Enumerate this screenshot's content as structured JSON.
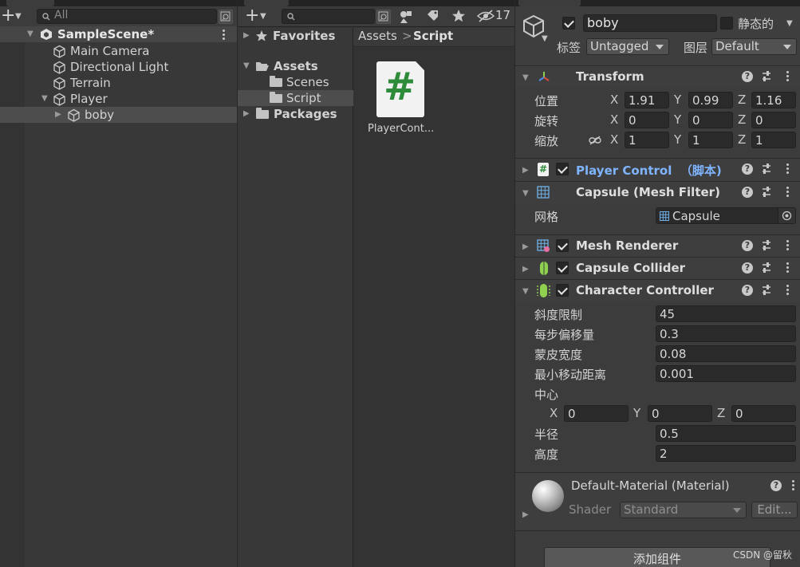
{
  "hierarchy": {
    "search_placeholder": "All",
    "scene": "SampleScene*",
    "items": [
      {
        "label": "Main Camera"
      },
      {
        "label": "Directional Light"
      },
      {
        "label": "Terrain"
      },
      {
        "label": "Player"
      },
      {
        "label": "boby"
      }
    ]
  },
  "project": {
    "hidden_count": "17",
    "tree": {
      "favorites": "Favorites",
      "assets": "Assets",
      "scenes": "Scenes",
      "script": "Script",
      "packages": "Packages"
    },
    "breadcrumb": {
      "root": "Assets",
      "sep": ">",
      "current": "Script"
    },
    "asset": {
      "icon_glyph": "#",
      "name": "PlayerCont..."
    }
  },
  "inspector": {
    "object_name": "boby",
    "static_label": "静态的",
    "tag_label": "标签",
    "tag_value": "Untagged",
    "layer_label": "图层",
    "layer_value": "Default",
    "transform": {
      "title": "Transform",
      "position_label": "位置",
      "rotation_label": "旋转",
      "scale_label": "缩放",
      "axis_x": "X",
      "axis_y": "Y",
      "axis_z": "Z",
      "position": {
        "x": "1.91",
        "y": "0.99",
        "z": "1.16"
      },
      "rotation": {
        "x": "0",
        "y": "0",
        "z": "0"
      },
      "scale": {
        "x": "1",
        "y": "1",
        "z": "1"
      }
    },
    "player_control": {
      "title": "Player Control  （脚本)"
    },
    "mesh_filter": {
      "title": "Capsule (Mesh Filter)",
      "mesh_label": "网格",
      "mesh_value": "Capsule"
    },
    "mesh_renderer": {
      "title": "Mesh Renderer"
    },
    "capsule_collider": {
      "title": "Capsule Collider"
    },
    "character_controller": {
      "title": "Character Controller",
      "slope_label": "斜度限制",
      "slope_value": "45",
      "step_label": "每步偏移量",
      "step_value": "0.3",
      "skin_label": "蒙皮宽度",
      "skin_value": "0.08",
      "min_move_label": "最小移动距离",
      "min_move_value": "0.001",
      "center_label": "中心",
      "center": {
        "x": "0",
        "y": "0",
        "z": "0"
      },
      "radius_label": "半径",
      "radius_value": "0.5",
      "height_label": "高度",
      "height_value": "2"
    },
    "material": {
      "title": "Default-Material (Material)",
      "shader_label": "Shader",
      "shader_value": "Standard",
      "edit_label": "Edit..."
    },
    "add_component": "添加组件"
  },
  "watermark": "CSDN @留秋",
  "colors": {
    "accent_link": "#7fb4ff",
    "script_green": "#2e8b3a",
    "panel": "#383838"
  }
}
